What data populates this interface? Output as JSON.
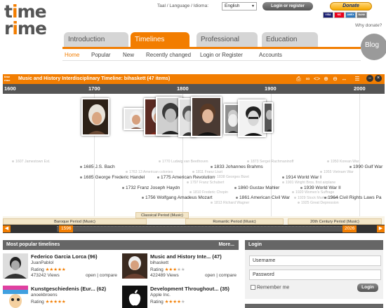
{
  "header": {
    "logo_top": [
      "t",
      "i",
      "m",
      "e"
    ],
    "logo_bottom": [
      "r",
      "i",
      "m",
      "e"
    ],
    "language_label": "Taal / Language / Idioma:",
    "language_value": "English",
    "login_register": "Login or register",
    "donate": "Donate",
    "cards": [
      "VISA",
      "MC",
      "AMEX",
      "BANK"
    ],
    "why_donate": "Why donate?"
  },
  "tabs": [
    {
      "label": "Introduction",
      "active": false
    },
    {
      "label": "Timelines",
      "active": true
    },
    {
      "label": "Professional",
      "active": false
    },
    {
      "label": "Education",
      "active": false
    }
  ],
  "blog": "Blog",
  "subnav": [
    "Home",
    "Popular",
    "New",
    "Recently changed",
    "Login or Register",
    "Accounts"
  ],
  "timeline": {
    "title": "Music and History Interdisciplinary Timeline: bihaskett  (47 items)",
    "logo": [
      "time",
      "rime"
    ],
    "toolbar_icons": [
      "print-icon",
      "link-icon",
      "code-icon",
      "zoom-in-icon",
      "zoom-out-icon",
      "fit-icon",
      "list-icon",
      "minus-icon",
      "close-icon"
    ],
    "scale_labels": [
      "1600",
      "1700",
      "1800",
      "1900",
      "2000"
    ],
    "events": [
      {
        "text": "1607 Jamestown Est.",
        "faded": true
      },
      {
        "text": "1685 J.S. Bach",
        "faded": false
      },
      {
        "text": "1685 George Frederic Handel",
        "faded": false
      },
      {
        "text": "1732 Franz Joseph Haydn",
        "faded": false
      },
      {
        "text": "1756 Wolfgang Amadeus Mozart",
        "faded": false
      },
      {
        "text": "1770 Ludwig van Beethoven",
        "faded": true
      },
      {
        "text": "1763 13 American colonies",
        "faded": true
      },
      {
        "text": "1775 American Revolution",
        "faded": false
      },
      {
        "text": "1811 Franz Liszt",
        "faded": true
      },
      {
        "text": "1797 Franz Schubert",
        "faded": true
      },
      {
        "text": "1833 Johannes Brahms",
        "faded": false
      },
      {
        "text": "1810 Frederic Chopin",
        "faded": true
      },
      {
        "text": "1813 Richard Wagner",
        "faded": true
      },
      {
        "text": "1838 Georges Bizet",
        "faded": true
      },
      {
        "text": "1873 Sergei Rachmaninoff",
        "faded": true
      },
      {
        "text": "1860 Gustav Mahler",
        "faded": false
      },
      {
        "text": "1861 American Civil War",
        "faded": false
      },
      {
        "text": "1914 World War I",
        "faded": false
      },
      {
        "text": "1939 World War II",
        "faded": false
      },
      {
        "text": "1901 Wright Bros. first airplane",
        "faded": true
      },
      {
        "text": "1920 Women's Suffrage",
        "faded": true
      },
      {
        "text": "1950 Korean War",
        "faded": true
      },
      {
        "text": "1955 Vietnam War",
        "faded": true
      },
      {
        "text": "1929 Stock Market Crash",
        "faded": true
      },
      {
        "text": "1925 Great Depression",
        "faded": true
      },
      {
        "text": "1990 Gulf War",
        "faded": false
      },
      {
        "text": "1964 Civil Rights Laws Pa",
        "faded": false
      }
    ],
    "periods": [
      "Baroque Period (Music)",
      "Classical Period (Music)",
      "Romantic Period (Music)",
      "20th Century Period (Music)"
    ],
    "range_start": "1596",
    "range_end": "2026"
  },
  "popular": {
    "heading": "Most popular timelines",
    "more": "More...",
    "items": [
      {
        "title": "Federico Garcia Lorca (96)",
        "user": "JuanPablol",
        "rating_label": "Rating",
        "rating": 4,
        "views": "473242 Views",
        "links": "open | compare"
      },
      {
        "title": "Music and History Inte... (47)",
        "user": "bihaskett",
        "rating_label": "Rating",
        "rating": 3,
        "views": "422489 Views",
        "links": "open | compare"
      },
      {
        "title": "Kunstgeschiedenis (Eur... (62)",
        "user": "anoekbroens",
        "rating_label": "Rating",
        "rating": 4,
        "views": "",
        "links": ""
      },
      {
        "title": "Development Throughout... (35)",
        "user": "Apple Inc.",
        "rating_label": "Rating",
        "rating": 4,
        "views": "",
        "links": ""
      }
    ]
  },
  "login": {
    "heading": "Login",
    "username": "Username",
    "password": "Password",
    "remember": "Remember me",
    "button": "Login"
  },
  "colors": {
    "accent": "#f27d00",
    "dark": "#555555"
  }
}
